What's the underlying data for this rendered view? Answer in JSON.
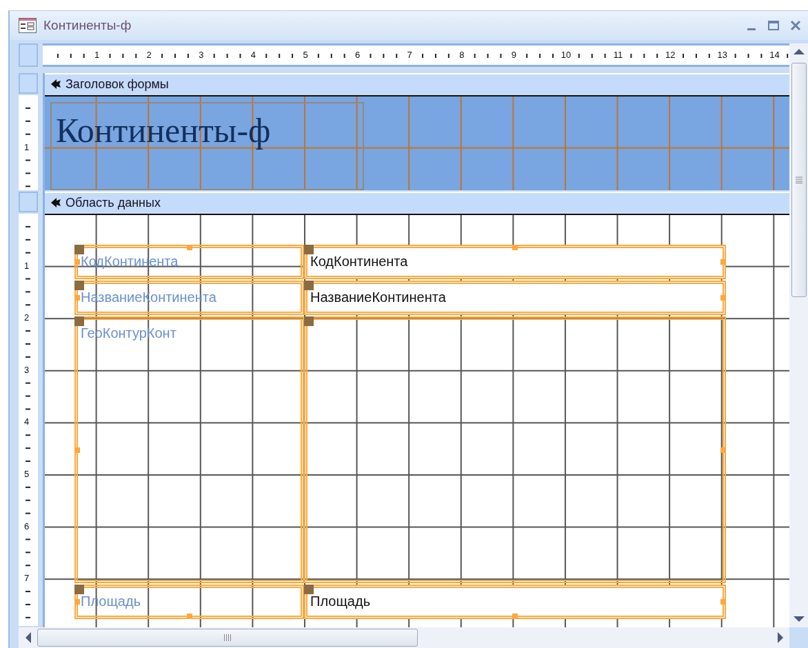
{
  "window": {
    "title": "Континенты-ф"
  },
  "ruler": {
    "horizontal": [
      "1",
      "2",
      "3",
      "4",
      "5",
      "6",
      "7",
      "8",
      "9",
      "10",
      "11",
      "12",
      "13",
      "14"
    ]
  },
  "sections": [
    {
      "title": "Заголовок формы",
      "kind": "header",
      "vertical_ruler": [
        "1"
      ],
      "title_label": "Континенты-ф"
    },
    {
      "title": "Область данных",
      "kind": "detail",
      "vertical_ruler": [
        "1",
        "2",
        "3",
        "4",
        "5",
        "6",
        "7"
      ],
      "controls": [
        {
          "label": "КодКонтинента",
          "kind": "textbox",
          "value": "КодКонтинента",
          "selected": true
        },
        {
          "label": "НазваниеКонтинента",
          "kind": "textbox",
          "value": "НазваниеКонтинента",
          "selected": true
        },
        {
          "label": "ГеоКонтурКонт",
          "kind": "object",
          "selected": true
        },
        {
          "label": "Площадь",
          "kind": "textbox",
          "value": "Площадь",
          "selected": true
        }
      ]
    }
  ]
}
